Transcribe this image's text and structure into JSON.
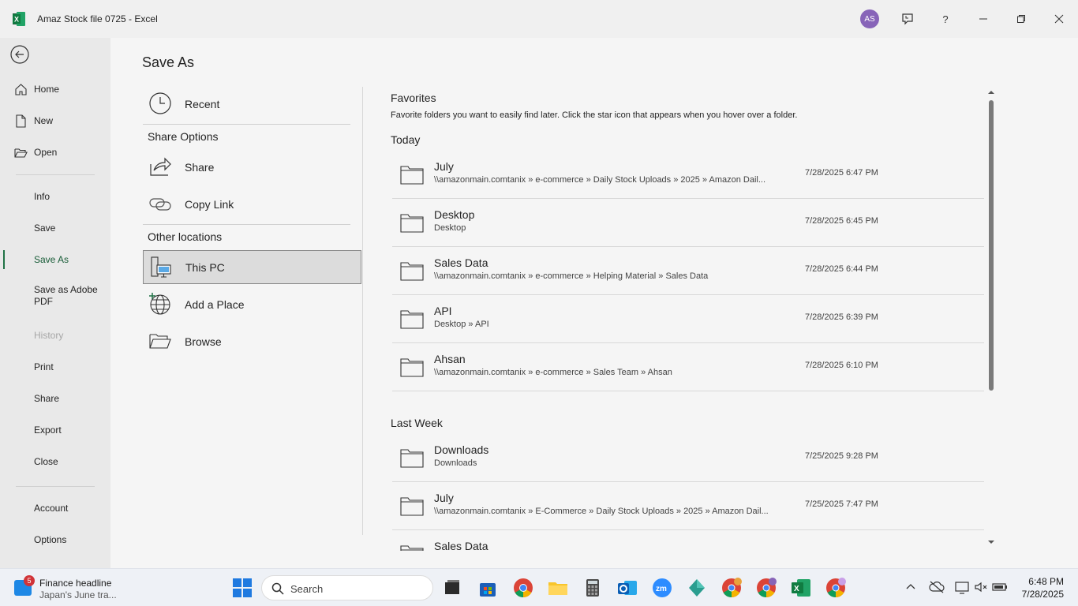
{
  "window": {
    "title": "Amaz Stock file 0725  -  Excel",
    "avatar_initials": "AS",
    "help_label": "?"
  },
  "nav": {
    "items": [
      {
        "label": "Home"
      },
      {
        "label": "New"
      },
      {
        "label": "Open"
      },
      {
        "label": "Info"
      },
      {
        "label": "Save"
      },
      {
        "label": "Save As"
      },
      {
        "label": "Save as Adobe PDF"
      },
      {
        "label": "History"
      },
      {
        "label": "Print"
      },
      {
        "label": "Share"
      },
      {
        "label": "Export"
      },
      {
        "label": "Close"
      },
      {
        "label": "Account"
      },
      {
        "label": "Options"
      }
    ]
  },
  "page": {
    "title": "Save As",
    "recent_label": "Recent",
    "share_options_heading": "Share Options",
    "share_label": "Share",
    "copy_link_label": "Copy Link",
    "other_locations_heading": "Other locations",
    "this_pc_label": "This PC",
    "add_place_label": "Add a Place",
    "browse_label": "Browse"
  },
  "favorites": {
    "title": "Favorites",
    "description": "Favorite folders you want to easily find later. Click the star icon that appears when you hover over a folder."
  },
  "today": {
    "heading": "Today",
    "rows": [
      {
        "name": "July",
        "path": "\\\\amazonmain.comtanix » e-commerce » Daily Stock Uploads » 2025 » Amazon Dail...",
        "date": "7/28/2025 6:47 PM"
      },
      {
        "name": "Desktop",
        "path": "Desktop",
        "date": "7/28/2025 6:45 PM"
      },
      {
        "name": "Sales Data",
        "path": "\\\\amazonmain.comtanix » e-commerce » Helping Material » Sales Data",
        "date": "7/28/2025 6:44 PM"
      },
      {
        "name": "API",
        "path": "Desktop » API",
        "date": "7/28/2025 6:39 PM"
      },
      {
        "name": "Ahsan",
        "path": "\\\\amazonmain.comtanix » e-commerce » Sales Team » Ahsan",
        "date": "7/28/2025 6:10 PM"
      }
    ]
  },
  "last_week": {
    "heading": "Last Week",
    "rows": [
      {
        "name": "Downloads",
        "path": "Downloads",
        "date": "7/25/2025 9:28 PM"
      },
      {
        "name": "July",
        "path": "\\\\amazonmain.comtanix » E-Commerce » Daily Stock Uploads » 2025 » Amazon Dail...",
        "date": "7/25/2025 7:47 PM"
      },
      {
        "name": "Sales Data",
        "path": "",
        "date": ""
      }
    ]
  },
  "taskbar": {
    "news_badge": "5",
    "news_title": "Finance headline",
    "news_subtitle": "Japan's June tra...",
    "search_placeholder": "Search",
    "clock_time": "6:48 PM",
    "clock_date": "7/28/2025"
  },
  "colors": {
    "accent": "#217346",
    "avatar": "#8764b8",
    "selected_bg": "#dcdcdc"
  }
}
